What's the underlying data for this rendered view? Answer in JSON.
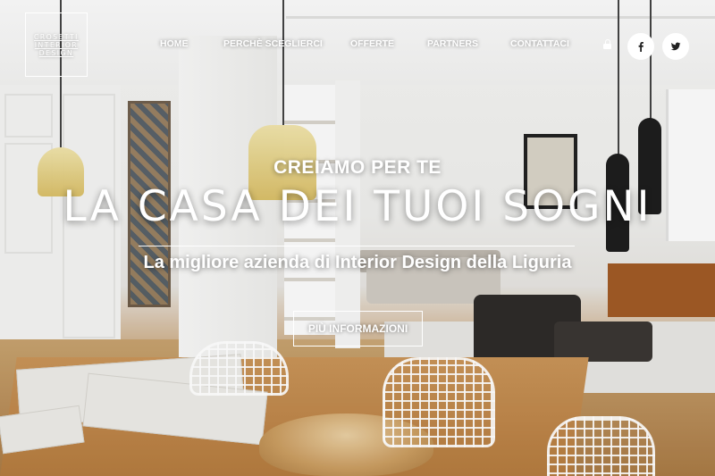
{
  "logo": {
    "line1": "CROSETTI",
    "line2": "INTERIOR",
    "line3": "DESIGN"
  },
  "nav": {
    "items": [
      {
        "label": "HOME"
      },
      {
        "label": "PERCHÈ SCEGLIERCI"
      },
      {
        "label": "OFFERTE"
      },
      {
        "label": "PARTNERS"
      },
      {
        "label": "CONTATTACI"
      }
    ],
    "lock_icon": "lock-icon"
  },
  "social": {
    "facebook_icon": "facebook-icon",
    "twitter_icon": "twitter-icon"
  },
  "hero": {
    "subtitle": "CREIAMO PER TE",
    "title": "LA CASA DEI TUOI SOGNI",
    "tagline": "La migliore azienda di Interior Design della Liguria",
    "cta_label": "PIÙ INFORMAZIONI"
  },
  "colors": {
    "text": "#ffffff",
    "social_bg": "#ffffff",
    "social_icon": "#222222"
  }
}
